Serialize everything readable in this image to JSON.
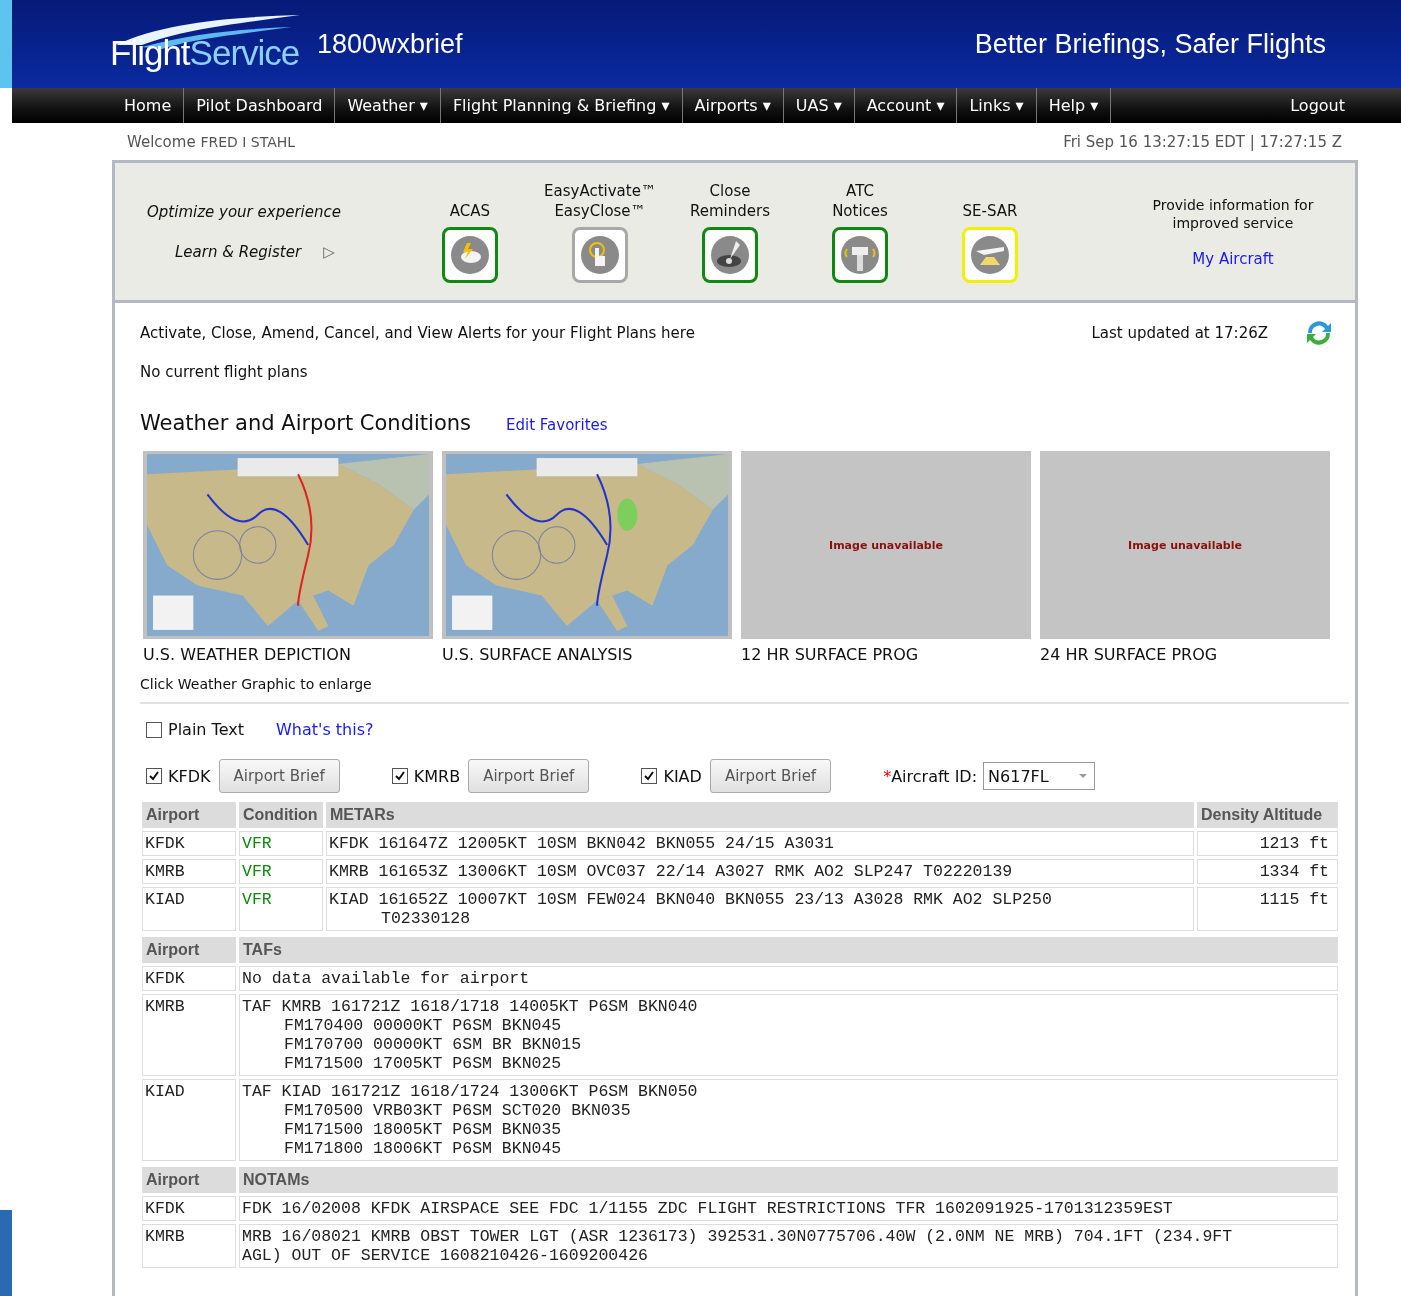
{
  "header": {
    "logo": [
      "Flight",
      "Service"
    ],
    "site": "1800wxbrief",
    "tagline": "Better Briefings, Safer Flights"
  },
  "nav": [
    {
      "label": "Home"
    },
    {
      "label": "Pilot Dashboard"
    },
    {
      "label": "Weather ▾"
    },
    {
      "label": "Flight Planning & Briefing ▾"
    },
    {
      "label": "Airports ▾"
    },
    {
      "label": "UAS ▾"
    },
    {
      "label": "Account ▾"
    },
    {
      "label": "Links ▾"
    },
    {
      "label": "Help ▾"
    }
  ],
  "logout": "Logout",
  "welcome": {
    "label": "Welcome",
    "name": "FRED I STAHL"
  },
  "datetime": "Fri Sep 16 13:27:15 EDT | 17:27:15 Z",
  "promo": {
    "title": "Optimize your experience",
    "link": "Learn & Register",
    "arrow": "▷",
    "features": [
      {
        "label": "ACAS",
        "kind": "cloud",
        "color": "#118811"
      },
      {
        "label": "EasyActivate™\nEasyClose™",
        "kind": "hand",
        "color": "#a8a8a8"
      },
      {
        "label": "Close\nReminders",
        "kind": "disc",
        "color": "#118811"
      },
      {
        "label": "ATC\nNotices",
        "kind": "tower",
        "color": "#118811"
      },
      {
        "label": "SE-SAR",
        "kind": "plane",
        "color": "#f0f000"
      }
    ],
    "info": "Provide information for\nimproved service",
    "info_link": "My Aircraft"
  },
  "flight_plans": {
    "message": "Activate, Close, Amend, Cancel, and View Alerts for your Flight Plans here",
    "updated": "Last updated at 17:26Z",
    "status": "No current flight plans"
  },
  "conditions": {
    "title": "Weather and Airport Conditions",
    "edit_link": "Edit Favorites",
    "graphics": [
      {
        "kind": "picture",
        "caption": "U.S. WEATHER DEPICTION"
      },
      {
        "kind": "picture",
        "caption": "U.S. SURFACE ANALYSIS"
      },
      {
        "kind": "unavailable",
        "message": "Image unavailable",
        "caption": "12 HR SURFACE PROG"
      },
      {
        "kind": "unavailable",
        "message": "Image unavailable",
        "caption": "24 HR SURFACE PROG"
      }
    ],
    "hint": "Click Weather Graphic to enlarge"
  },
  "plain_text": {
    "label": "Plain Text",
    "checked": false
  },
  "help_link": "What's this?",
  "airports": [
    {
      "code": "KFDK",
      "checked": true,
      "button": "Airport Brief"
    },
    {
      "code": "KMRB",
      "checked": true,
      "button": "Airport Brief"
    },
    {
      "code": "KIAD",
      "checked": true,
      "button": "Airport Brief"
    }
  ],
  "aircraft": {
    "required_mark": "*",
    "label": "Aircraft ID:",
    "value": "N617FL"
  },
  "metars": {
    "columns": [
      "Airport",
      "Condition",
      "METARs",
      "Density Altitude"
    ],
    "rows": [
      {
        "airport": "KFDK",
        "condition": "VFR",
        "lines": [
          "KFDK 161647Z 12005KT 10SM BKN042 BKN055 24/15 A3031"
        ],
        "density_altitude": "1213 ft"
      },
      {
        "airport": "KMRB",
        "condition": "VFR",
        "lines": [
          "KMRB 161653Z 13006KT 10SM OVC037 22/14 A3027 RMK AO2 SLP247 T02220139"
        ],
        "density_altitude": "1334 ft"
      },
      {
        "airport": "KIAD",
        "condition": "VFR",
        "lines": [
          "KIAD 161652Z 10007KT 10SM FEW024 BKN040 BKN055 23/13 A3028 RMK AO2 SLP250",
          "T02330128"
        ],
        "density_altitude": "1115 ft"
      }
    ]
  },
  "tafs": {
    "columns": [
      "Airport",
      "TAFs"
    ],
    "rows": [
      {
        "airport": "KFDK",
        "lines": [
          "No data available for airport"
        ]
      },
      {
        "airport": "KMRB",
        "lines": [
          "TAF KMRB 161721Z 1618/1718 14005KT P6SM BKN040",
          "FM170400 00000KT P6SM BKN045",
          "FM170700 00000KT 6SM BR BKN015",
          "FM171500 17005KT P6SM BKN025"
        ]
      },
      {
        "airport": "KIAD",
        "lines": [
          "TAF KIAD 161721Z 1618/1724 13006KT P6SM BKN050",
          "FM170500 VRB03KT P6SM SCT020 BKN035",
          "FM171500 18005KT P6SM BKN035",
          "FM171800 18006KT P6SM BKN045"
        ]
      }
    ]
  },
  "notams": {
    "columns": [
      "Airport",
      "NOTAMs"
    ],
    "rows": [
      {
        "airport": "KFDK",
        "lines": [
          "FDK 16/02008 KFDK AIRSPACE SEE FDC 1/1155 ZDC FLIGHT RESTRICTIONS TFR 1602091925-1701312359EST"
        ]
      },
      {
        "airport": "KMRB",
        "lines": [
          "MRB 16/08021 KMRB OBST TOWER LGT (ASR 1236173) 392531.30N0775706.40W (2.0NM NE MRB) 704.1FT (234.9FT",
          "AGL) OUT OF SERVICE 1608210426-1609200426"
        ]
      }
    ]
  }
}
